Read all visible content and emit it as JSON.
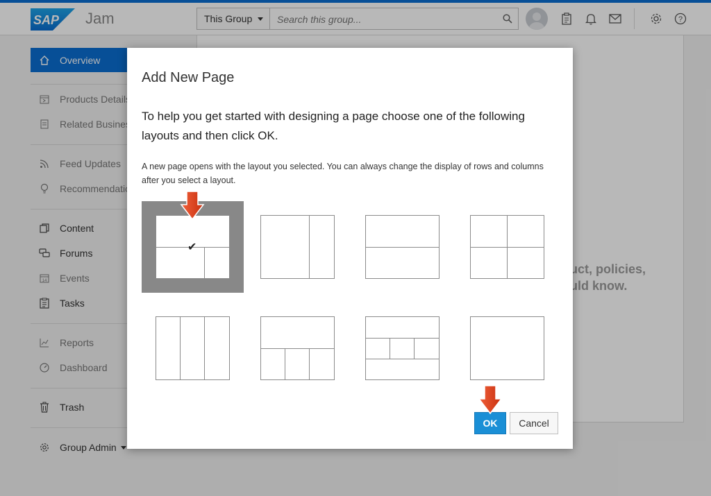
{
  "header": {
    "logo_text": "SAP",
    "app_name": "Jam",
    "scope_label": "This Group",
    "search_placeholder": "Search this group...",
    "icons": [
      "search-icon",
      "avatar",
      "tasks-icon",
      "bell-icon",
      "mail-icon",
      "gear-icon",
      "help-icon"
    ]
  },
  "sidebar": {
    "active": "Overview",
    "items": [
      {
        "label": "Products Details",
        "icon": "products-icon",
        "dim": true
      },
      {
        "label": "Related Business",
        "icon": "related-icon",
        "dim": true
      },
      {
        "label": "Feed Updates",
        "icon": "feed-icon",
        "dim": true
      },
      {
        "label": "Recommendations",
        "icon": "bulb-icon",
        "dim": true
      },
      {
        "label": "Content",
        "icon": "content-icon",
        "dim": false
      },
      {
        "label": "Forums",
        "icon": "forums-icon",
        "dim": false
      },
      {
        "label": "Events",
        "icon": "events-icon",
        "dim": true
      },
      {
        "label": "Tasks",
        "icon": "tasks-icon",
        "dim": false
      },
      {
        "label": "Reports",
        "icon": "reports-icon",
        "dim": true
      },
      {
        "label": "Dashboard",
        "icon": "dashboard-icon",
        "dim": true
      },
      {
        "label": "Trash",
        "icon": "trash-icon",
        "dim": false
      },
      {
        "label": "Group Admin",
        "icon": "gear-icon",
        "dim": false
      }
    ]
  },
  "background": {
    "line1": "duct, policies,",
    "line2": "ould know."
  },
  "dialog": {
    "title": "Add New Page",
    "lead": "To help you get started with designing a page choose one of the following layouts and then click OK.",
    "description": "A new page opens with the layout you selected. You can always change the display of rows and columns after you select a layout.",
    "selected_layout": 1,
    "ok_label": "OK",
    "cancel_label": "Cancel"
  },
  "colors": {
    "brand_blue": "#0a6ed1",
    "ok_blue": "#1a8fd6",
    "arrow_red": "#e0401c",
    "selected_gray": "#888888"
  }
}
